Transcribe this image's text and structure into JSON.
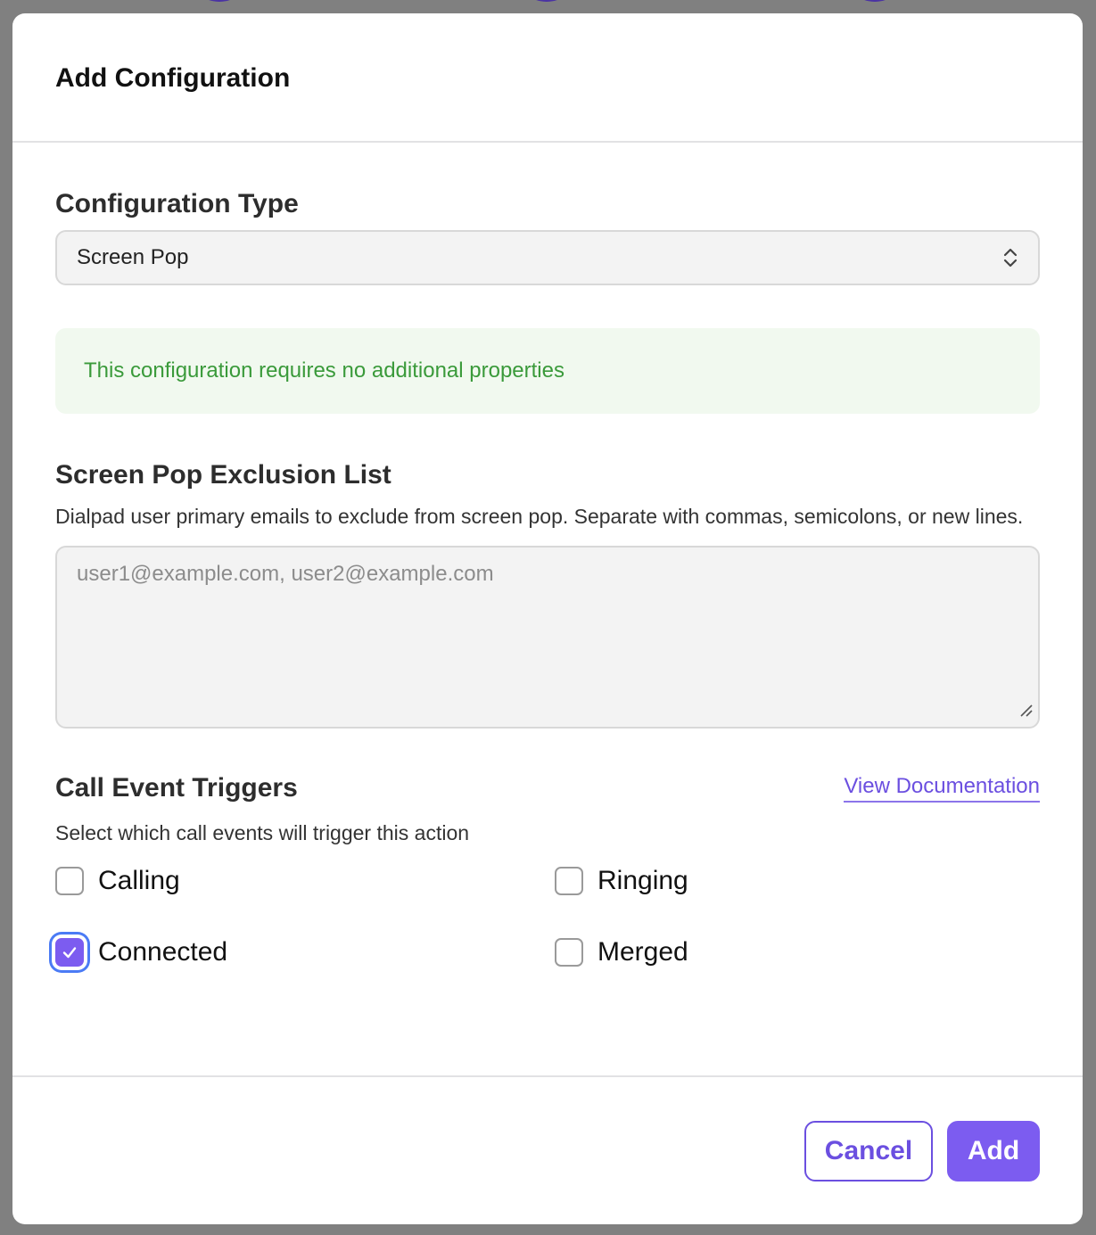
{
  "modal": {
    "title": "Add Configuration"
  },
  "config_type": {
    "label": "Configuration Type",
    "selected": "Screen Pop",
    "info": "This configuration requires no additional properties"
  },
  "exclusion": {
    "label": "Screen Pop Exclusion List",
    "description": "Dialpad user primary emails to exclude from screen pop. Separate with commas, semicolons, or new lines.",
    "placeholder": "user1@example.com, user2@example.com",
    "value": ""
  },
  "triggers": {
    "label": "Call Event Triggers",
    "doc_link": "View Documentation",
    "description": "Select which call events will trigger this action",
    "items": [
      {
        "label": "Calling",
        "checked": false
      },
      {
        "label": "Ringing",
        "checked": false
      },
      {
        "label": "Connected",
        "checked": true
      },
      {
        "label": "Merged",
        "checked": false
      }
    ]
  },
  "footer": {
    "cancel_label": "Cancel",
    "add_label": "Add"
  },
  "colors": {
    "accent": "#7c5cf0",
    "success_text": "#3a9a3a",
    "success_bg": "#f1f9ef",
    "focus_ring": "#4b7bf5",
    "backdrop": "#808080"
  },
  "icons": {
    "select_chevrons": "chevron-up-down-icon",
    "resize": "resize-handle-icon",
    "checkmark": "checkmark-icon"
  }
}
